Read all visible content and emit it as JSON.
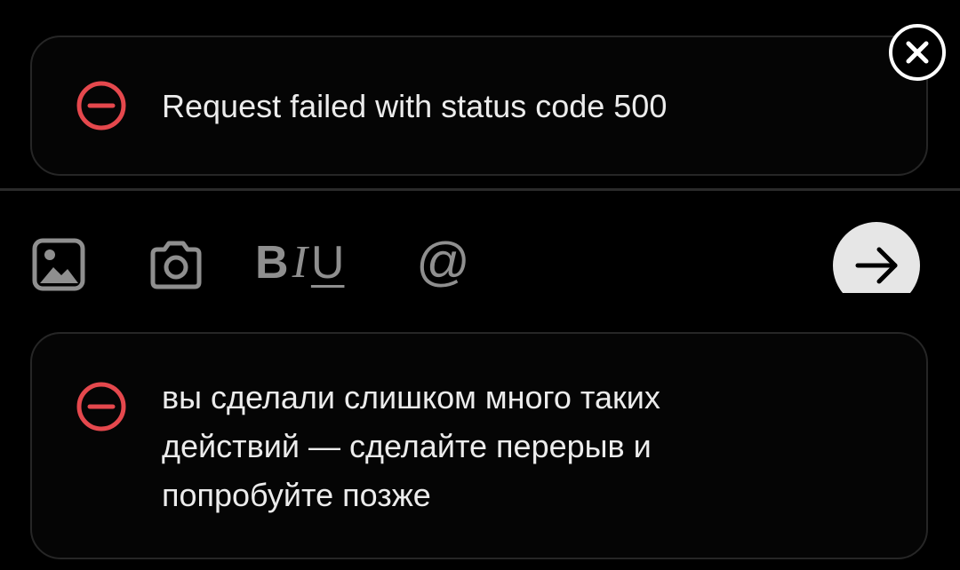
{
  "toasts": [
    {
      "icon": "error-minus-icon",
      "message": "Request failed with status code 500"
    },
    {
      "icon": "error-minus-icon",
      "message": "вы сделали слишком много таких\nдействий — сделайте перерыв и\nпопробуйте позже"
    }
  ],
  "close": {
    "icon": "close-icon"
  },
  "toolbar": {
    "image_icon": "image-icon",
    "camera_icon": "camera-icon",
    "bold_label": "B",
    "italic_label": "I",
    "underline_label": "U",
    "mention_label": "@",
    "send_icon": "arrow-right-icon"
  },
  "colors": {
    "error": "#e5484d",
    "background": "#000000",
    "toast_border": "#262626",
    "toolbar_icon": "#8f8f8f",
    "send_button": "#e6e6e6"
  }
}
